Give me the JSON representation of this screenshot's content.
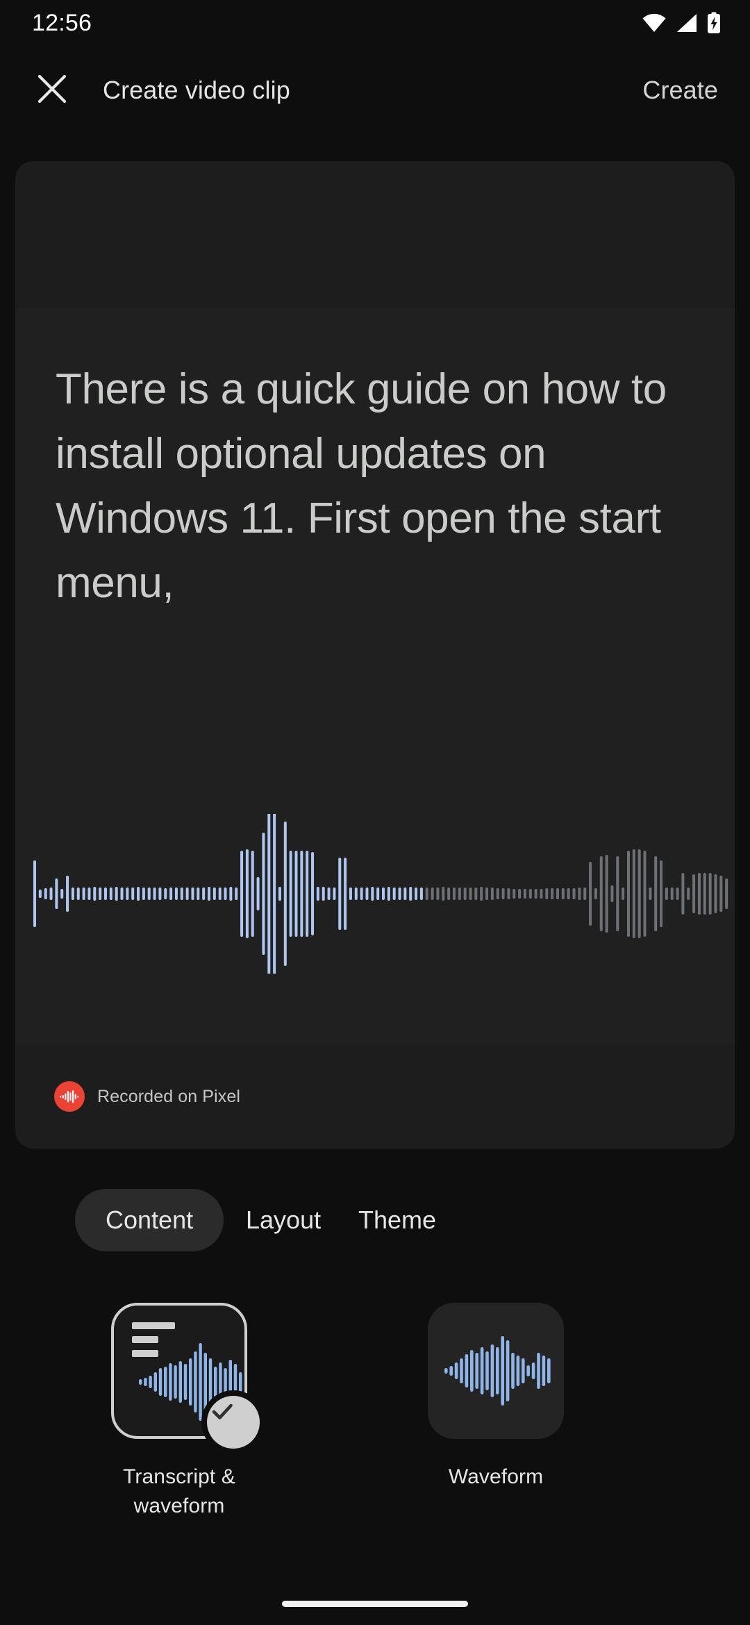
{
  "status_bar": {
    "time": "12:56",
    "icons": [
      "wifi-icon",
      "cellular-signal-icon",
      "battery-charging-icon"
    ]
  },
  "app_bar": {
    "close_icon": "close-icon",
    "title": "Create video clip",
    "action_label": "Create"
  },
  "preview": {
    "transcript": "There is a quick guide on how to install optional updates on Windows 11. First open the start menu,",
    "badge": {
      "icon": "recorder-app-icon",
      "label": "Recorded on Pixel",
      "icon_color": "#ea4335"
    },
    "waveform_accent": "#aec6f0",
    "waveform_muted": "#6d7177"
  },
  "tabs": [
    {
      "label": "Content",
      "selected": true
    },
    {
      "label": "Layout",
      "selected": false
    },
    {
      "label": "Theme",
      "selected": false
    }
  ],
  "options": [
    {
      "label": "Transcript & waveform",
      "selected": true,
      "thumb_icon": "transcript-waveform-thumb",
      "check_icon": "check-icon"
    },
    {
      "label": "Waveform",
      "selected": false,
      "thumb_icon": "waveform-thumb"
    }
  ],
  "nav_bar": {
    "handle": "home-gesture-handle"
  },
  "colors": {
    "background": "#0e0e0e",
    "card": "#1d1d1d",
    "card_inner": "#202020",
    "accent_blue": "#8fb4e8",
    "text_primary": "#e6e6e6",
    "text_secondary": "#c6c6c6",
    "brand_red": "#ea4335"
  }
}
